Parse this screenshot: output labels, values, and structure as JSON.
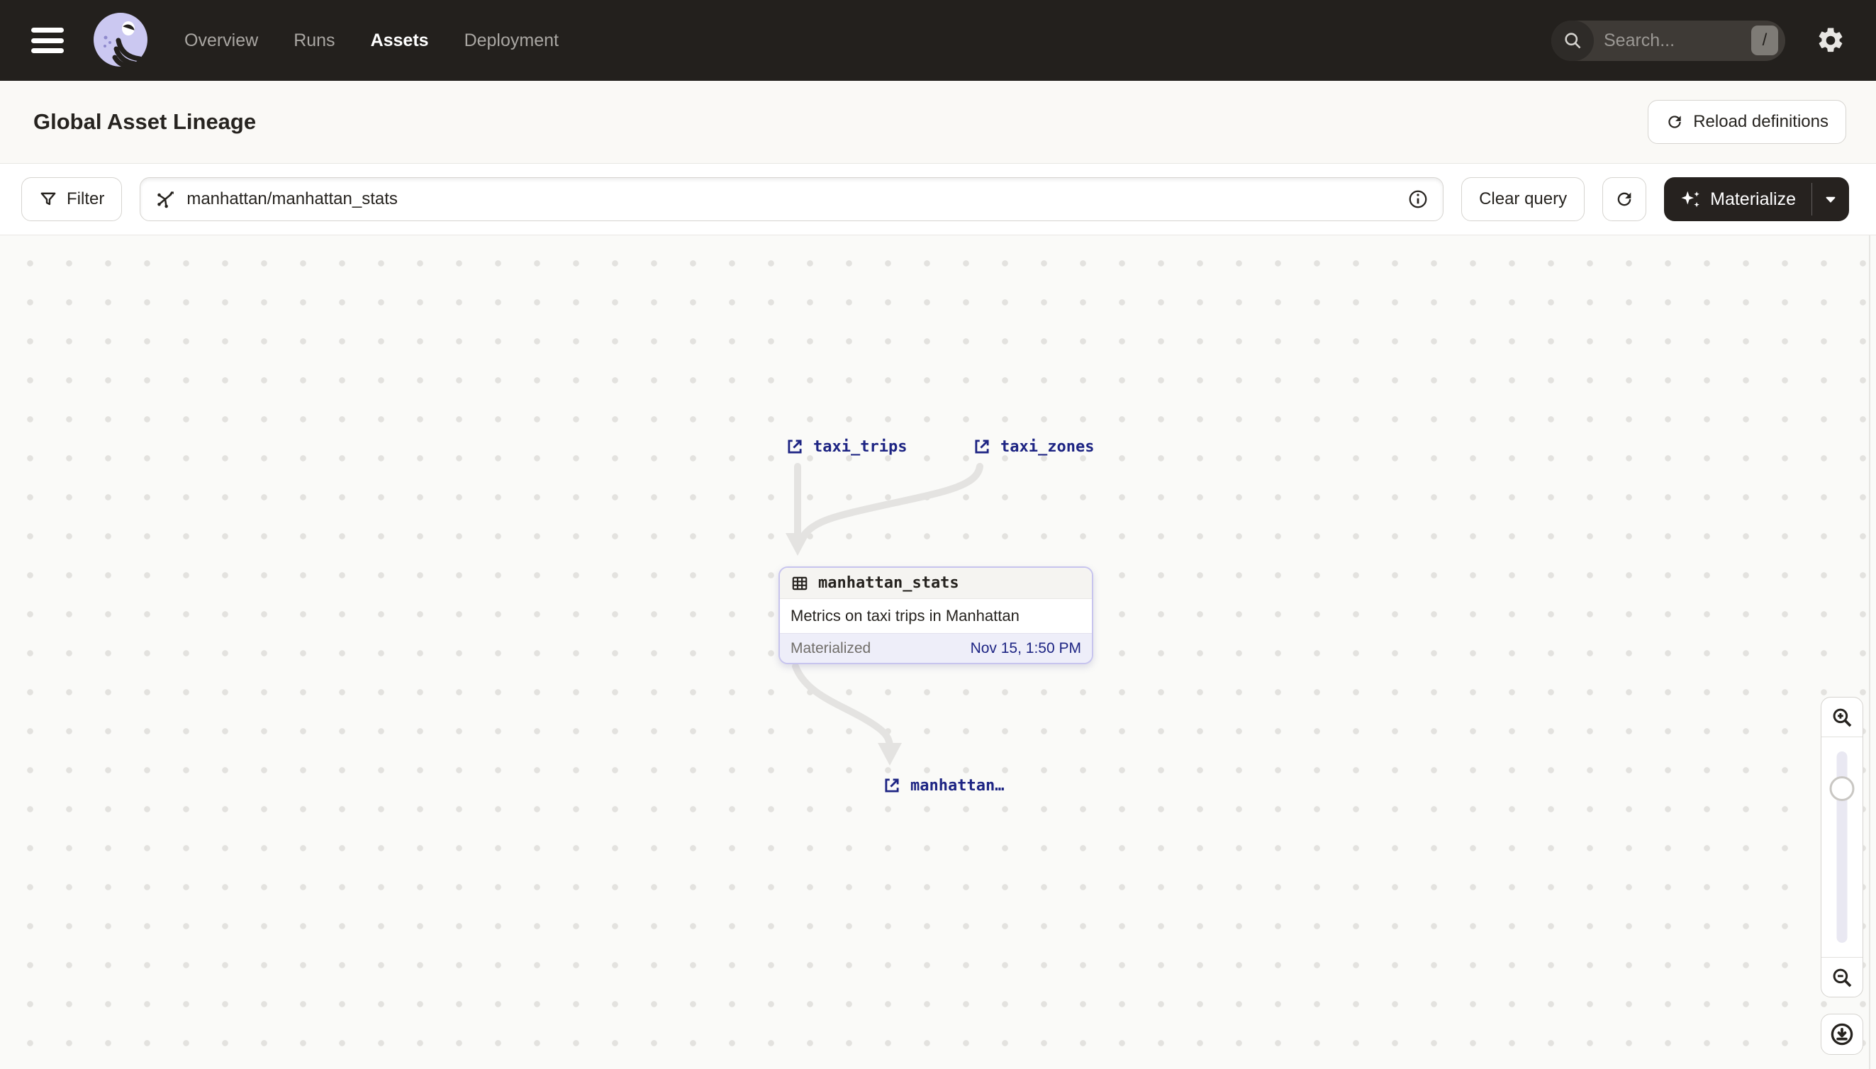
{
  "nav": {
    "menu": [
      {
        "label": "Overview",
        "active": false
      },
      {
        "label": "Runs",
        "active": false
      },
      {
        "label": "Assets",
        "active": true
      },
      {
        "label": "Deployment",
        "active": false
      }
    ],
    "search": {
      "placeholder": "Search...",
      "shortcut": "/"
    }
  },
  "page": {
    "title": "Global Asset Lineage",
    "reload_label": "Reload definitions"
  },
  "toolbar": {
    "filter_label": "Filter",
    "query_value": "manhattan/manhattan_stats",
    "clear_label": "Clear query",
    "materialize_label": "Materialize"
  },
  "graph": {
    "upstream": [
      {
        "label": "taxi_trips"
      },
      {
        "label": "taxi_zones"
      }
    ],
    "selected_asset": {
      "name": "manhattan_stats",
      "description": "Metrics on taxi trips in Manhattan",
      "status": "Materialized",
      "materialized_at": "Nov 15, 1:50 PM"
    },
    "downstream": [
      {
        "label": "manhattan…"
      }
    ]
  },
  "colors": {
    "nav_bg": "#23201D",
    "page_bg": "#FAFAF8",
    "asset_link_text": "#1D2483",
    "selected_card_border": "#C7C4EE",
    "selected_card_footer_bg": "#EEEEF9",
    "edge": "#E4E3E1",
    "materialize_button_bg": "#26221F"
  }
}
